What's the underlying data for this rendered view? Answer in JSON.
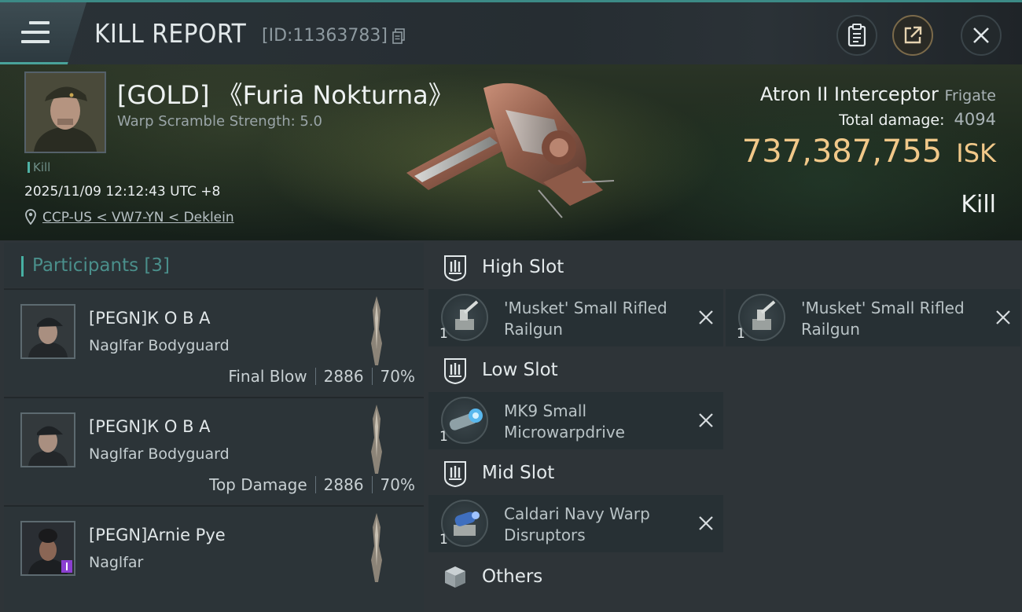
{
  "header": {
    "title": "KILL REPORT",
    "report_id": "[ID:11363783]"
  },
  "victim": {
    "name": "[GOLD] 《Furia Nokturna》",
    "warp_scramble": "Warp Scramble Strength: 5.0",
    "kill_tag": "Kill",
    "datetime": "2025/11/09 12:12:43 UTC +8",
    "location": "CCP-US < VW7-YN < Deklein"
  },
  "ship": {
    "name": "Atron II Interceptor",
    "class": "Frigate",
    "total_damage_label": "Total damage:",
    "total_damage": "4094",
    "isk_value": "737,387,755",
    "isk_unit": "ISK",
    "result": "Kill"
  },
  "participants": {
    "label": "Participants",
    "count": "[3]",
    "items": [
      {
        "name": "[PEGN]К О В А",
        "ship": "Naglfar Bodyguard",
        "role": "Final Blow",
        "damage": "2886",
        "percent": "70%"
      },
      {
        "name": "[PEGN]К О В А",
        "ship": "Naglfar Bodyguard",
        "role": "Top Damage",
        "damage": "2886",
        "percent": "70%"
      },
      {
        "name": "[PEGN]Arnie Pye",
        "ship": "Naglfar"
      }
    ]
  },
  "slots": {
    "high": {
      "label": "High Slot",
      "modules": [
        {
          "qty": "1",
          "name": "'Musket' Small Rifled Railgun"
        },
        {
          "qty": "1",
          "name": "'Musket' Small Rifled Railgun"
        }
      ]
    },
    "low": {
      "label": "Low Slot",
      "modules": [
        {
          "qty": "1",
          "name": "MK9 Small Microwarpdrive"
        }
      ]
    },
    "mid": {
      "label": "Mid Slot",
      "modules": [
        {
          "qty": "1",
          "name": "Caldari Navy Warp Disruptors"
        }
      ]
    },
    "others": {
      "label": "Others"
    }
  },
  "colors": {
    "accent_teal": "#47b0a3",
    "isk_gold": "#f1c889",
    "panel_bg": "#2c3438"
  }
}
